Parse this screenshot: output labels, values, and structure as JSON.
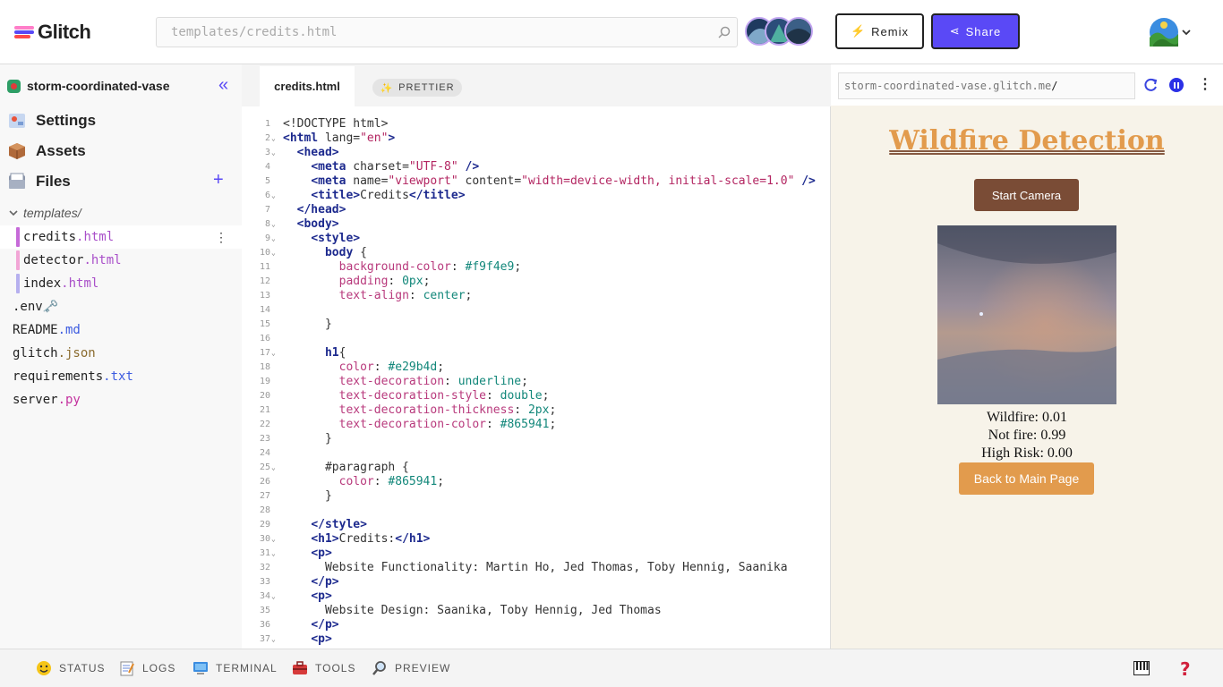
{
  "header": {
    "logo_text": "Glitch",
    "search_placeholder": "templates/credits.html",
    "remix_label": "Remix",
    "share_label": "Share",
    "brand_color": "#5a49f6"
  },
  "sidebar": {
    "project_name": "storm-coordinated-vase",
    "nav": [
      {
        "label": "Settings",
        "icon": "settings-icon"
      },
      {
        "label": "Assets",
        "icon": "package-icon"
      },
      {
        "label": "Files",
        "icon": "files-icon"
      }
    ],
    "folder": "templates/",
    "folder_files": [
      {
        "name": "credits",
        "ext": ".html",
        "color": "#c66ad8"
      },
      {
        "name": "detector",
        "ext": ".html",
        "color": "#f2a6d6"
      },
      {
        "name": "index",
        "ext": ".html",
        "color": "#b6b0ef"
      }
    ],
    "root_files": [
      {
        "name": ".env",
        "ext": " 🗝️",
        "ext_class": "ext-orange"
      },
      {
        "name": "README",
        "ext": ".md",
        "ext_class": "ext-blue"
      },
      {
        "name": "glitch",
        "ext": ".json",
        "ext_class": "ext-orange"
      },
      {
        "name": "requirements",
        "ext": ".txt",
        "ext_class": "ext-blue"
      },
      {
        "name": "server",
        "ext": ".py",
        "ext_class": "ext-red"
      }
    ]
  },
  "editor": {
    "tab_label": "credits.html",
    "prettier_label": "PRETTIER",
    "lines": [
      {
        "n": "1",
        "fold": false,
        "indent": "",
        "html": "&lt;!DOCTYPE html&gt;"
      },
      {
        "n": "2",
        "fold": true,
        "indent": "",
        "html": "<span class='tk-tag'>&lt;html</span> lang=<span class='tk-str'>\"en\"</span><span class='tk-tag'>&gt;</span>"
      },
      {
        "n": "3",
        "fold": true,
        "indent": "  ",
        "html": "<span class='tk-tag'>&lt;head&gt;</span>"
      },
      {
        "n": "4",
        "fold": false,
        "indent": "    ",
        "html": "<span class='tk-tag'>&lt;meta</span> charset=<span class='tk-str'>\"UTF-8\"</span> <span class='tk-tag'>/&gt;</span>"
      },
      {
        "n": "5",
        "fold": false,
        "indent": "    ",
        "html": "<span class='tk-tag'>&lt;meta</span> name=<span class='tk-str'>\"viewport\"</span> content=<span class='tk-str'>\"width=device-width, initial-scale=1.0\"</span> <span class='tk-tag'>/&gt;</span>"
      },
      {
        "n": "6",
        "fold": true,
        "indent": "    ",
        "html": "<span class='tk-tag'>&lt;title&gt;</span>Credits<span class='tk-tag'>&lt;/title&gt;</span>"
      },
      {
        "n": "7",
        "fold": false,
        "indent": "  ",
        "html": "<span class='tk-tag'>&lt;/head&gt;</span>"
      },
      {
        "n": "8",
        "fold": true,
        "indent": "  ",
        "html": "<span class='tk-tag'>&lt;body&gt;</span>"
      },
      {
        "n": "9",
        "fold": true,
        "indent": "    ",
        "html": "<span class='tk-tag'>&lt;style&gt;</span>"
      },
      {
        "n": "10",
        "fold": true,
        "indent": "      ",
        "html": "<span class='tk-tag'>body</span> {"
      },
      {
        "n": "11",
        "fold": false,
        "indent": "        ",
        "html": "<span class='tk-prop'>background-color</span>: <span class='tk-val'>#f9f4e9</span>;"
      },
      {
        "n": "12",
        "fold": false,
        "indent": "        ",
        "html": "<span class='tk-prop'>padding</span>: <span class='tk-val'>0px</span>;"
      },
      {
        "n": "13",
        "fold": false,
        "indent": "        ",
        "html": "<span class='tk-prop'>text-align</span>: <span class='tk-val'>center</span>;"
      },
      {
        "n": "14",
        "fold": false,
        "indent": "",
        "html": ""
      },
      {
        "n": "15",
        "fold": false,
        "indent": "      ",
        "html": "}"
      },
      {
        "n": "16",
        "fold": false,
        "indent": "",
        "html": ""
      },
      {
        "n": "17",
        "fold": true,
        "indent": "      ",
        "html": "<span class='tk-tag'>h1</span>{"
      },
      {
        "n": "18",
        "fold": false,
        "indent": "        ",
        "html": "<span class='tk-prop'>color</span>: <span class='tk-val'>#e29b4d</span>;"
      },
      {
        "n": "19",
        "fold": false,
        "indent": "        ",
        "html": "<span class='tk-prop'>text-decoration</span>: <span class='tk-val'>underline</span>;"
      },
      {
        "n": "20",
        "fold": false,
        "indent": "        ",
        "html": "<span class='tk-prop'>text-decoration-style</span>: <span class='tk-val'>double</span>;"
      },
      {
        "n": "21",
        "fold": false,
        "indent": "        ",
        "html": "<span class='tk-prop'>text-decoration-thickness</span>: <span class='tk-val'>2px</span>;"
      },
      {
        "n": "22",
        "fold": false,
        "indent": "        ",
        "html": "<span class='tk-prop'>text-decoration-color</span>: <span class='tk-val'>#865941</span>;"
      },
      {
        "n": "23",
        "fold": false,
        "indent": "      ",
        "html": "}"
      },
      {
        "n": "24",
        "fold": false,
        "indent": "",
        "html": ""
      },
      {
        "n": "25",
        "fold": true,
        "indent": "      ",
        "html": "#paragraph {"
      },
      {
        "n": "26",
        "fold": false,
        "indent": "        ",
        "html": "<span class='tk-prop'>color</span>: <span class='tk-val'>#865941</span>;"
      },
      {
        "n": "27",
        "fold": false,
        "indent": "      ",
        "html": "}"
      },
      {
        "n": "28",
        "fold": false,
        "indent": "",
        "html": ""
      },
      {
        "n": "29",
        "fold": false,
        "indent": "    ",
        "html": "<span class='tk-tag'>&lt;/style&gt;</span>"
      },
      {
        "n": "30",
        "fold": true,
        "indent": "    ",
        "html": "<span class='tk-tag'>&lt;h1&gt;</span>Credits:<span class='tk-tag'>&lt;/h1&gt;</span>"
      },
      {
        "n": "31",
        "fold": true,
        "indent": "    ",
        "html": "<span class='tk-tag'>&lt;p&gt;</span>"
      },
      {
        "n": "32",
        "fold": false,
        "indent": "      ",
        "html": "Website Functionality: Martin Ho, Jed Thomas, Toby Hennig, Saanika"
      },
      {
        "n": "33",
        "fold": false,
        "indent": "    ",
        "html": "<span class='tk-tag'>&lt;/p&gt;</span>"
      },
      {
        "n": "34",
        "fold": true,
        "indent": "    ",
        "html": "<span class='tk-tag'>&lt;p&gt;</span>"
      },
      {
        "n": "35",
        "fold": false,
        "indent": "      ",
        "html": "Website Design: Saanika, Toby Hennig, Jed Thomas"
      },
      {
        "n": "36",
        "fold": false,
        "indent": "    ",
        "html": "<span class='tk-tag'>&lt;/p&gt;</span>"
      },
      {
        "n": "37",
        "fold": true,
        "indent": "    ",
        "html": "<span class='tk-tag'>&lt;p&gt;</span>"
      }
    ]
  },
  "preview": {
    "url_base": "storm-coordinated-vase.glitch.me",
    "url_path": "/",
    "title": "Wildfire Detection",
    "start_camera_label": "Start Camera",
    "stats": [
      "Wildfire: 0.01",
      "Not fire: 0.99",
      "High Risk: 0.00"
    ],
    "back_label": "Back to Main Page"
  },
  "bottombar": {
    "items": [
      {
        "label": "STATUS",
        "icon": "smile-icon"
      },
      {
        "label": "LOGS",
        "icon": "notepad-icon"
      },
      {
        "label": "TERMINAL",
        "icon": "computer-icon"
      },
      {
        "label": "TOOLS",
        "icon": "toolbox-icon"
      },
      {
        "label": "PREVIEW",
        "icon": "magnifier-icon"
      }
    ],
    "help_label": "?"
  }
}
